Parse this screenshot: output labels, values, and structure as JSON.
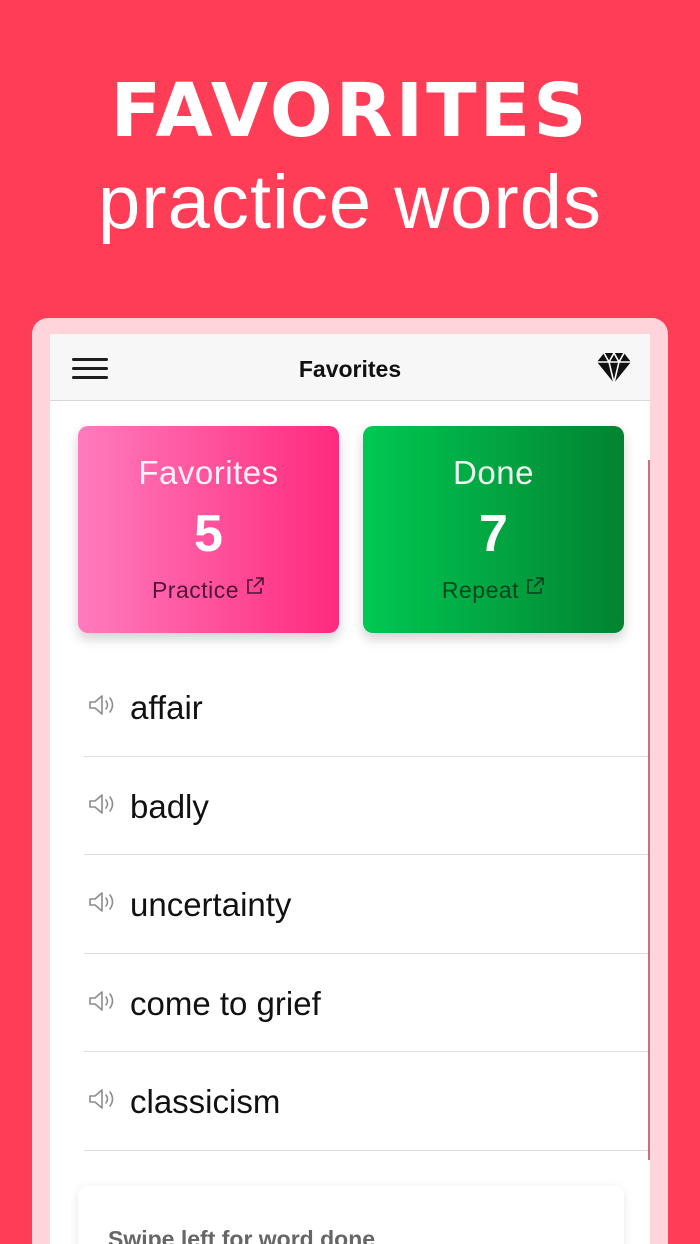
{
  "promo": {
    "headline": "FAVORITES",
    "subline": "practice words"
  },
  "navbar": {
    "title": "Favorites",
    "menu_icon": "hamburger-menu-icon",
    "premium_icon": "diamond-icon"
  },
  "cards": {
    "favorites": {
      "label": "Favorites",
      "count": "5",
      "action": "Practice",
      "action_icon": "external-link-icon"
    },
    "done": {
      "label": "Done",
      "count": "7",
      "action": "Repeat",
      "action_icon": "external-link-icon"
    }
  },
  "words": [
    {
      "text": "affair",
      "icon": "speaker-icon"
    },
    {
      "text": "badly",
      "icon": "speaker-icon"
    },
    {
      "text": "uncertainty",
      "icon": "speaker-icon"
    },
    {
      "text": "come to grief",
      "icon": "speaker-icon"
    },
    {
      "text": "classicism",
      "icon": "speaker-icon"
    }
  ],
  "hint": {
    "text": "Swipe left for word done"
  },
  "colors": {
    "background": "#ff3d57",
    "favorites_card_start": "#ff7bbd",
    "favorites_card_end": "#ff2a7d",
    "done_card_start": "#00c853",
    "done_card_end": "#038330"
  }
}
